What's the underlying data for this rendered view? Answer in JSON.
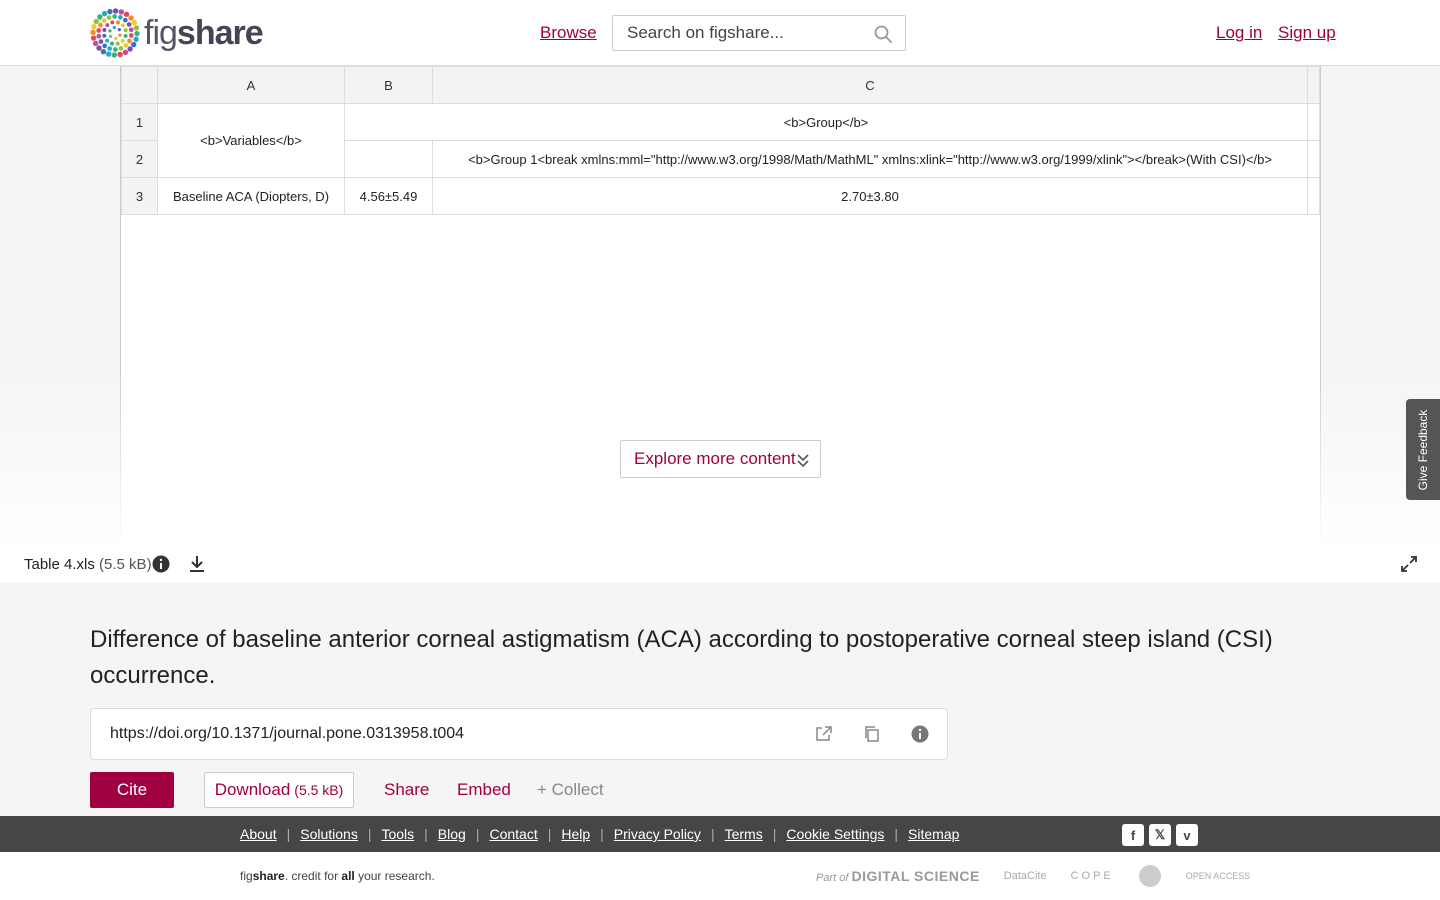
{
  "header": {
    "logo_text_light": "fig",
    "logo_text_bold": "share",
    "browse": "Browse",
    "search_placeholder": "Search on figshare...",
    "login": "Log in",
    "signup": "Sign up"
  },
  "sheet": {
    "columns": [
      "A",
      "B",
      "C"
    ],
    "rows": [
      "1",
      "2",
      "3"
    ],
    "cell_variables": "<b>Variables</b>",
    "cell_group": "<b>Group</b>",
    "cell_group1": "<b>Group 1<break xmlns:mml=\"http://www.w3.org/1998/Math/MathML\" xmlns:xlink=\"http://www.w3.org/1999/xlink\"></break>(With CSI)</b>",
    "cell_baseline": "Baseline ACA (Diopters, D)",
    "cell_b3": "4.56±5.49",
    "cell_c3": "2.70±3.80"
  },
  "explore": "Explore more content",
  "file": {
    "name": "Table 4.xls",
    "size": "(5.5 kB)"
  },
  "feedback": "Give Feedback",
  "item": {
    "title": "Difference of baseline anterior corneal astigmatism (ACA) according to postoperative corneal steep island (CSI) occurrence.",
    "doi": "https://doi.org/10.1371/journal.pone.0313958.t004"
  },
  "actions": {
    "cite": "Cite",
    "download": "Download",
    "download_size": "(5.5 kB)",
    "share": "Share",
    "embed": "Embed",
    "collect": "+ Collect"
  },
  "footer": {
    "links": [
      "About",
      "Solutions",
      "Tools",
      "Blog",
      "Contact",
      "Help",
      "Privacy Policy",
      "Terms",
      "Cookie Settings",
      "Sitemap"
    ],
    "tagline_fig": "fig",
    "tagline_share": "share",
    "tagline_mid": ". credit for ",
    "tagline_all": "all",
    "tagline_end": " your research.",
    "partner_ds_prefix": "Part of",
    "partner_ds_name": "DIGITAL SCIENCE",
    "partner_datacite": "DataCite",
    "partner_cope": "COPE",
    "partner_oa": "OPEN ACCESS"
  },
  "colors": {
    "accent": "#a00040",
    "footer_bg": "#464646"
  }
}
